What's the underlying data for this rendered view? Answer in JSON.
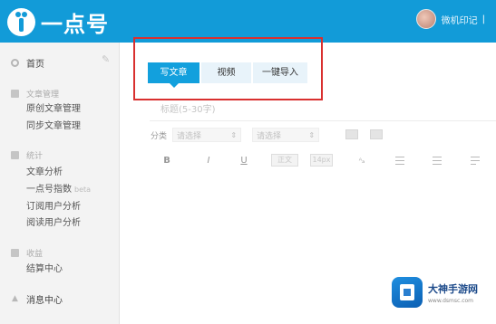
{
  "header": {
    "app_title": "一点号",
    "user_name": "微机印记",
    "user_caret": "|"
  },
  "sidebar": {
    "home": {
      "label": "首页",
      "icon": "home-icon"
    },
    "edit_icon": "edit-icon",
    "sections": [
      {
        "label": "文章管理",
        "icon": "article-icon",
        "items": [
          "原创文章管理",
          "同步文章管理"
        ]
      },
      {
        "label": "统计",
        "icon": "stats-icon",
        "items": [
          "文章分析",
          "一点号指数",
          "订阅用户分析",
          "阅读用户分析"
        ]
      },
      {
        "label": "收益",
        "icon": "settlement-icon",
        "items": [
          "结算中心"
        ]
      }
    ],
    "index_beta": "beta",
    "message_center": {
      "label": "消息中心",
      "icon": "person-icon"
    }
  },
  "editor": {
    "tabs": [
      {
        "label": "写文章",
        "active": true
      },
      {
        "label": "视频",
        "active": false
      },
      {
        "label": "一键导入",
        "active": false
      }
    ],
    "title_placeholder": "标题(5-30字)",
    "category_label": "分类",
    "category_select_1": "请选择",
    "category_select_2": "请选择",
    "toolbar": {
      "bold": "B",
      "italic": "I",
      "underline": "U",
      "font_box_1": "正文",
      "font_box_2": "14px",
      "clear": "ᴬₐ"
    }
  },
  "watermark": {
    "title": "大神手游网",
    "url": "www.dsmsc.com"
  },
  "colors": {
    "header_bg": "#129bd8",
    "active_tab": "#12a0dd",
    "highlight_border": "#d9302f"
  }
}
